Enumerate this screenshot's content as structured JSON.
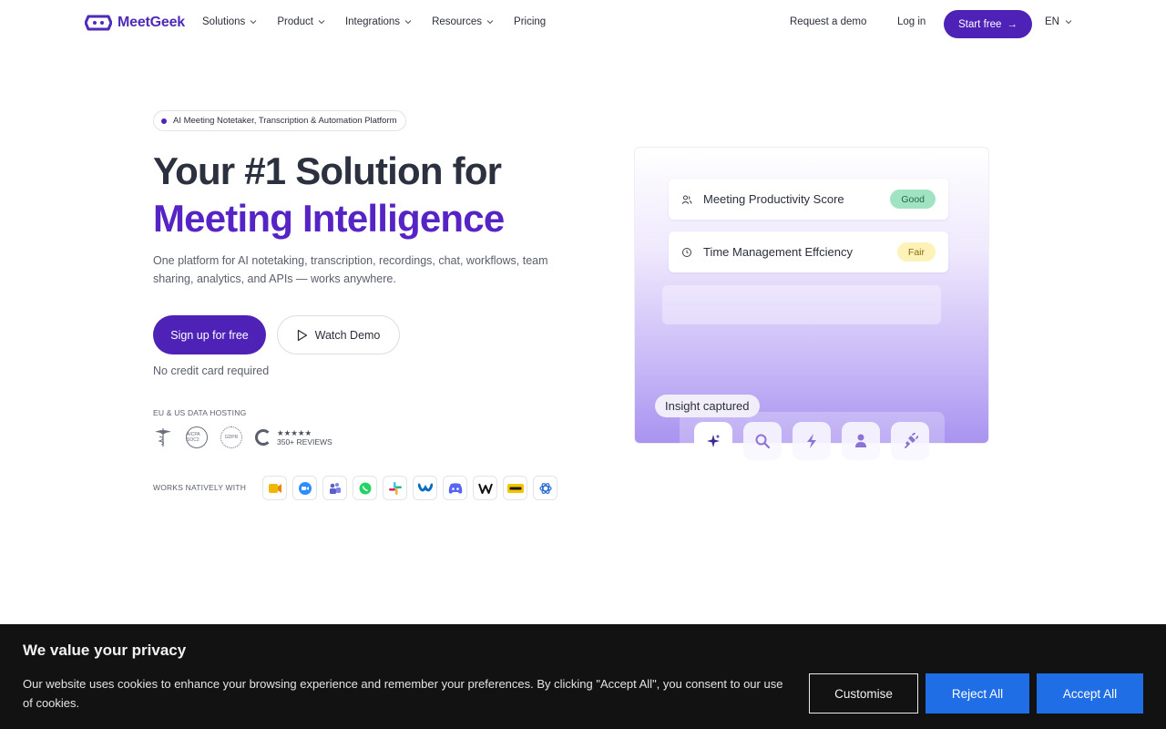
{
  "nav": {
    "brand": "MeetGeek",
    "links": [
      {
        "label": "Solutions",
        "has_menu": true
      },
      {
        "label": "Product",
        "has_menu": true
      },
      {
        "label": "Integrations",
        "has_menu": true
      },
      {
        "label": "Resources",
        "has_menu": true
      },
      {
        "label": "Pricing",
        "has_menu": false
      }
    ],
    "request_demo": "Request a demo",
    "login": "Log in",
    "start_free": "Start free",
    "start_arrow": "→",
    "language": "EN"
  },
  "hero": {
    "badge": "AI Meeting Notetaker, Transcription & Automation Platform",
    "title_line1": "Your #1 Solution for",
    "title_line2": "Meeting Intelligence",
    "subtitle": "One platform for AI notetaking, transcription, recordings, chat, workflows, team sharing, analytics, and APIs — works anywhere.",
    "signup_label": "Sign up for free",
    "watch_label": "Watch Demo",
    "no_credit_card": "No credit card required",
    "hosting_label": "EU & US DATA HOSTING",
    "certs": [
      {
        "icon": "hipaa-caduceus-icon",
        "text": ""
      },
      {
        "icon": "aicpa-soc2-icon",
        "text": "AICPA SOC2"
      },
      {
        "icon": "gdpr-stars-icon",
        "text": "GDPR"
      }
    ],
    "g2": {
      "stars": "★★★★★",
      "reviews": "350+ REVIEWS"
    },
    "works_label": "WORKS NATIVELY WITH",
    "apps": [
      {
        "icon": "google-meet-icon",
        "color": "#f2b705"
      },
      {
        "icon": "zoom-icon",
        "color": "#2d8cff"
      },
      {
        "icon": "teams-icon",
        "color": "#5b5fc7"
      },
      {
        "icon": "whatsapp-icon",
        "color": "#25d366"
      },
      {
        "icon": "slack-icon",
        "color": "#e01e5a"
      },
      {
        "icon": "webex-icon",
        "color": "#0a6cbf"
      },
      {
        "icon": "discord-icon",
        "color": "#5865f2"
      },
      {
        "icon": "wordpress-w-icon",
        "color": "#111111"
      },
      {
        "icon": "gotomeeting-icon",
        "color": "#f5c400"
      },
      {
        "icon": "openai-icon",
        "color": "#2c6fd6"
      }
    ]
  },
  "panel": {
    "rows": [
      {
        "icon": "users-icon",
        "label": "Meeting Productivity Score",
        "status": "Good"
      },
      {
        "icon": "clock-icon",
        "label": "Time Management Effciency",
        "status": "Fair"
      }
    ],
    "insight": "Insight captured",
    "tools": [
      {
        "icon": "sparkle-icon"
      },
      {
        "icon": "search-icon"
      },
      {
        "icon": "lightning-icon"
      },
      {
        "icon": "person-icon"
      },
      {
        "icon": "plug-icon"
      }
    ]
  },
  "cookie": {
    "title": "We value your privacy",
    "text": "Our website uses cookies to enhance your browsing experience and remember your preferences. By clicking \"Accept All\", you consent to our use of cookies.",
    "customise": "Customise",
    "reject": "Reject All",
    "accept": "Accept All"
  },
  "colors": {
    "brand": "#4f22b7",
    "title_accent": "#5624c4",
    "cookie_bg": "#121212",
    "cookie_button": "#1f6ee6"
  }
}
